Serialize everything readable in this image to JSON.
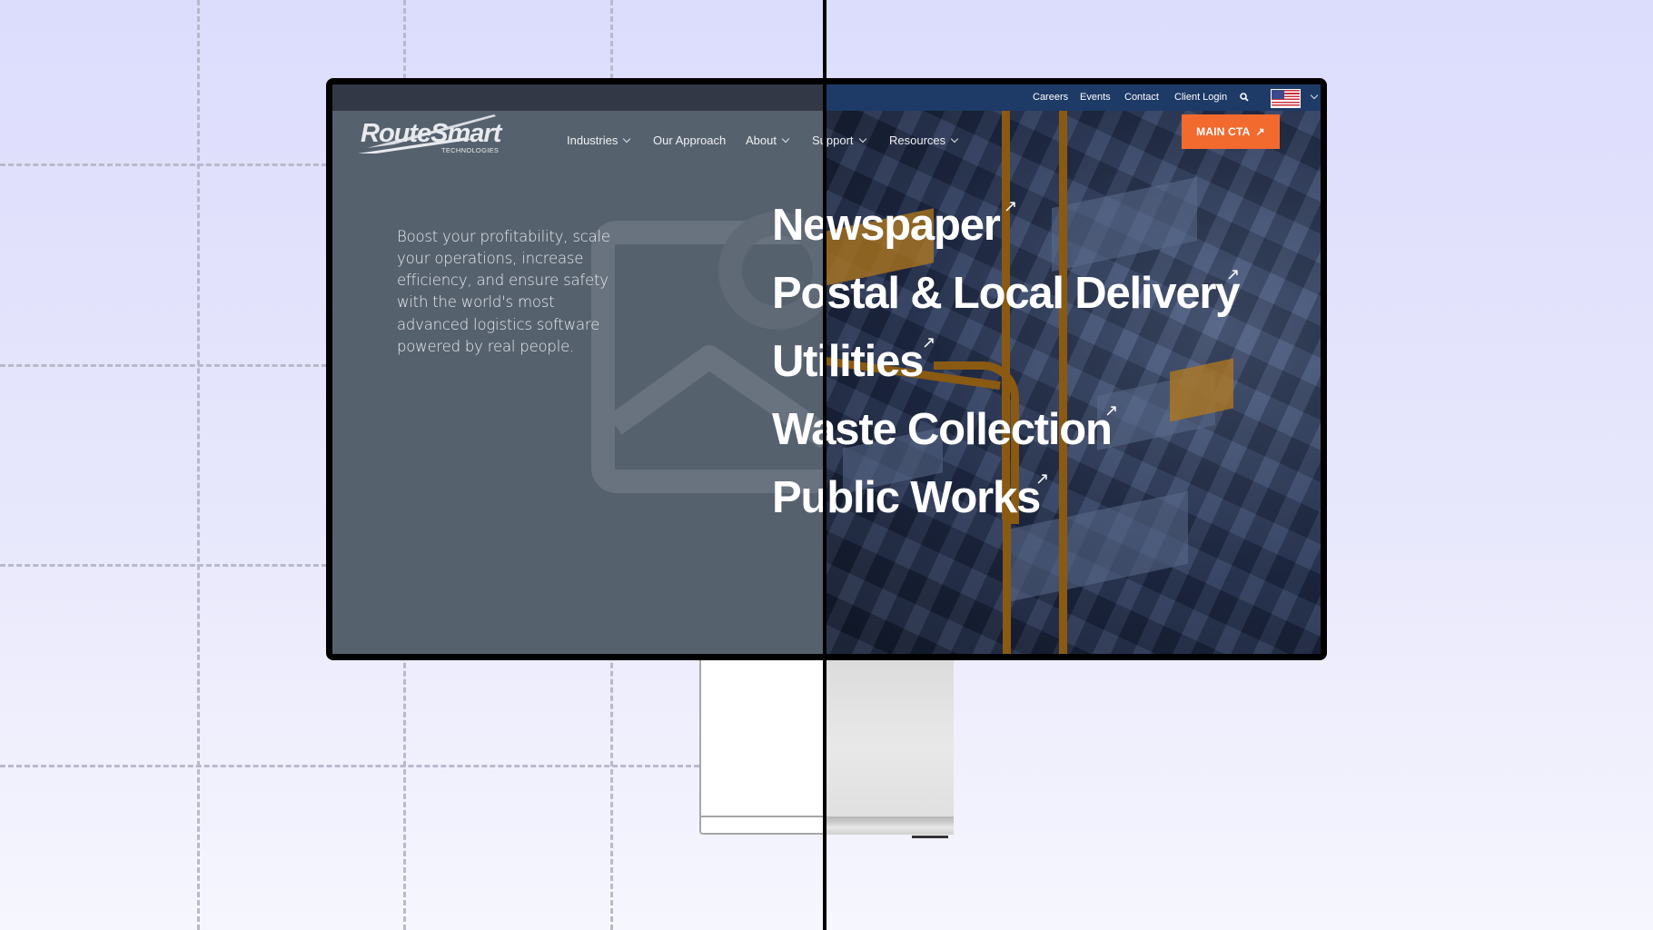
{
  "brand": {
    "logo_text": "RouteSmart",
    "logo_subtext": "TECHNOLOGIES"
  },
  "utility_nav": {
    "items": [
      "Careers",
      "Events",
      "Contact",
      "Client Login"
    ],
    "search_icon": "search-icon",
    "locale_flag": "us-flag-icon",
    "locale_chevron": "chevron-down-icon"
  },
  "main_nav": {
    "items": [
      {
        "label": "Industries",
        "has_dropdown": true
      },
      {
        "label": "Our Approach",
        "has_dropdown": false
      },
      {
        "label": "About",
        "has_dropdown": true
      },
      {
        "label": "Support",
        "has_dropdown": true
      },
      {
        "label": "Resources",
        "has_dropdown": true
      }
    ],
    "cta_label": "MAIN CTA",
    "cta_icon": "arrow-up-right-icon"
  },
  "hero": {
    "description": "Boost your profitability, scale your operations, increase efficiency, and ensure safety with the world's most advanced logistics software powered by real people.",
    "industries": [
      {
        "label": "Newspaper",
        "icon": "↗"
      },
      {
        "label": "Postal & Local Delivery",
        "icon": "↗"
      },
      {
        "label": "Utilities",
        "icon": "↗"
      },
      {
        "label": "Waste Collection",
        "icon": "↗"
      },
      {
        "label": "Public Works",
        "icon": "↗"
      }
    ]
  },
  "colors": {
    "cta": "#f26a2e",
    "wireframe_bg": "#56616e",
    "topbar_wireframe": "#333846",
    "topbar_final": "#1e3a66",
    "route_highlight": "#8a5a12",
    "canvas_bg": "#dcdcfd"
  }
}
